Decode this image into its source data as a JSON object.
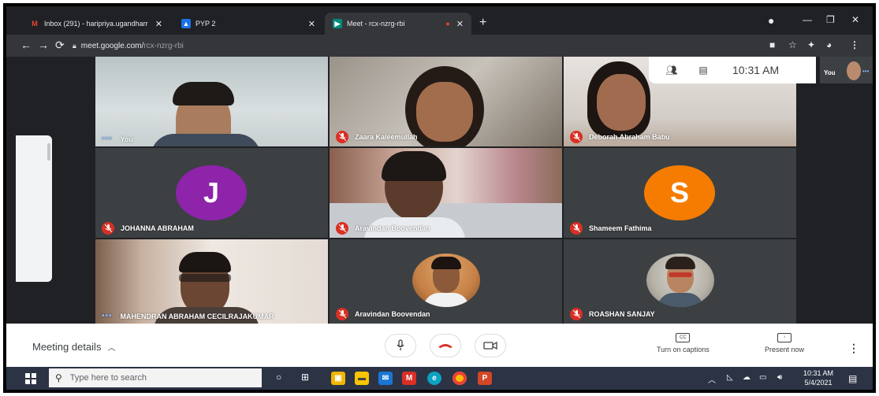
{
  "browser": {
    "tabs": [
      {
        "title": "Inbox (291) - haripriya.ugandharr",
        "icon": "gmail-icon"
      },
      {
        "title": "PYP 2",
        "icon": "app-icon"
      },
      {
        "title": "Meet - rcx-nzrg-rbi",
        "icon": "meet-icon"
      }
    ],
    "url_domain": "meet.google.com/",
    "url_path": "rcx-nzrg-rbi"
  },
  "meet": {
    "time": "10:31 AM",
    "self_label": "You",
    "participants": [
      {
        "name": "You",
        "muted": false
      },
      {
        "name": "Zaara Kaleemullah",
        "muted": true
      },
      {
        "name": "Deborah Abraham Babu",
        "muted": true
      },
      {
        "name": "JOHANNA ABRAHAM",
        "muted": true,
        "initial": "J",
        "avatar_color": "#8e24aa"
      },
      {
        "name": "Aravindan Boovendan",
        "muted": true
      },
      {
        "name": "Shameem Fathima",
        "muted": true,
        "initial": "S",
        "avatar_color": "#f57c00"
      },
      {
        "name": "MAHENDRAN ABRAHAM CECILRAJAKUMAR",
        "muted": false
      },
      {
        "name": "Aravindan Boovendan",
        "muted": true
      },
      {
        "name": "ROASHAN SANJAY",
        "muted": true
      }
    ],
    "meeting_details": "Meeting details",
    "captions_label": "Turn on captions",
    "present_label": "Present now"
  },
  "taskbar": {
    "search_placeholder": "Type here to search",
    "time": "10:31 AM",
    "date": "5/4/2021"
  }
}
